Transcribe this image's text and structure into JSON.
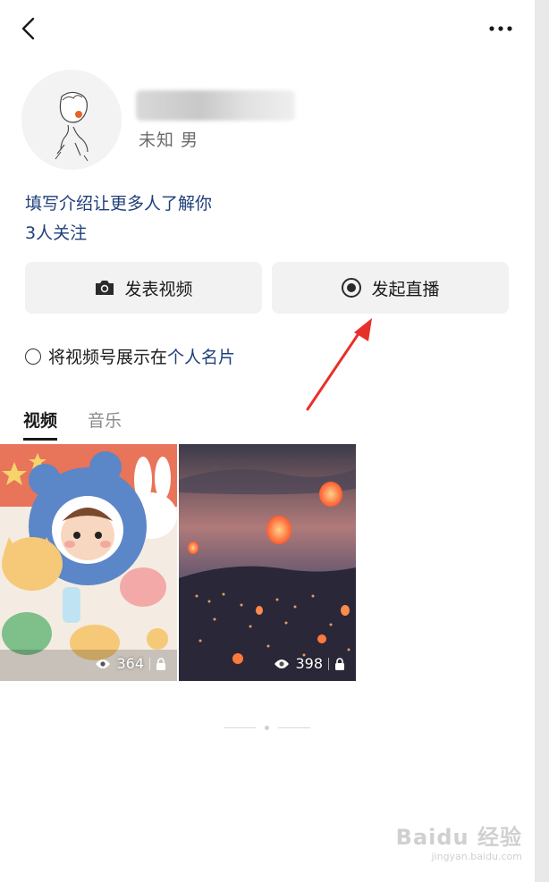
{
  "header": {
    "back_icon": "chevron-left-icon",
    "more_icon": "ellipsis-icon"
  },
  "profile": {
    "meta": "未知 男",
    "intro_prompt": "填写介绍让更多人了解你",
    "followers": "3人关注"
  },
  "actions": {
    "post_video_label": "发表视频",
    "post_video_icon": "camera-icon",
    "go_live_label": "发起直播",
    "go_live_icon": "live-record-icon"
  },
  "card_toggle": {
    "label_prefix": "将视频号展示在",
    "label_link": "个人名片"
  },
  "tabs": [
    {
      "label": "视频",
      "active": true
    },
    {
      "label": "音乐",
      "active": false
    }
  ],
  "videos": [
    {
      "views": "364",
      "locked": true,
      "theme": "cartoon-baby-with-bunny-and-cat"
    },
    {
      "views": "398",
      "locked": true,
      "theme": "sky-lanterns-at-dusk"
    }
  ],
  "watermark": {
    "logo": "Baidu 经验",
    "url": "jingyan.baidu.com"
  },
  "colors": {
    "link_blue": "#1f3f7a",
    "button_bg": "#f2f2f2",
    "arrow_red": "#e8302a"
  }
}
